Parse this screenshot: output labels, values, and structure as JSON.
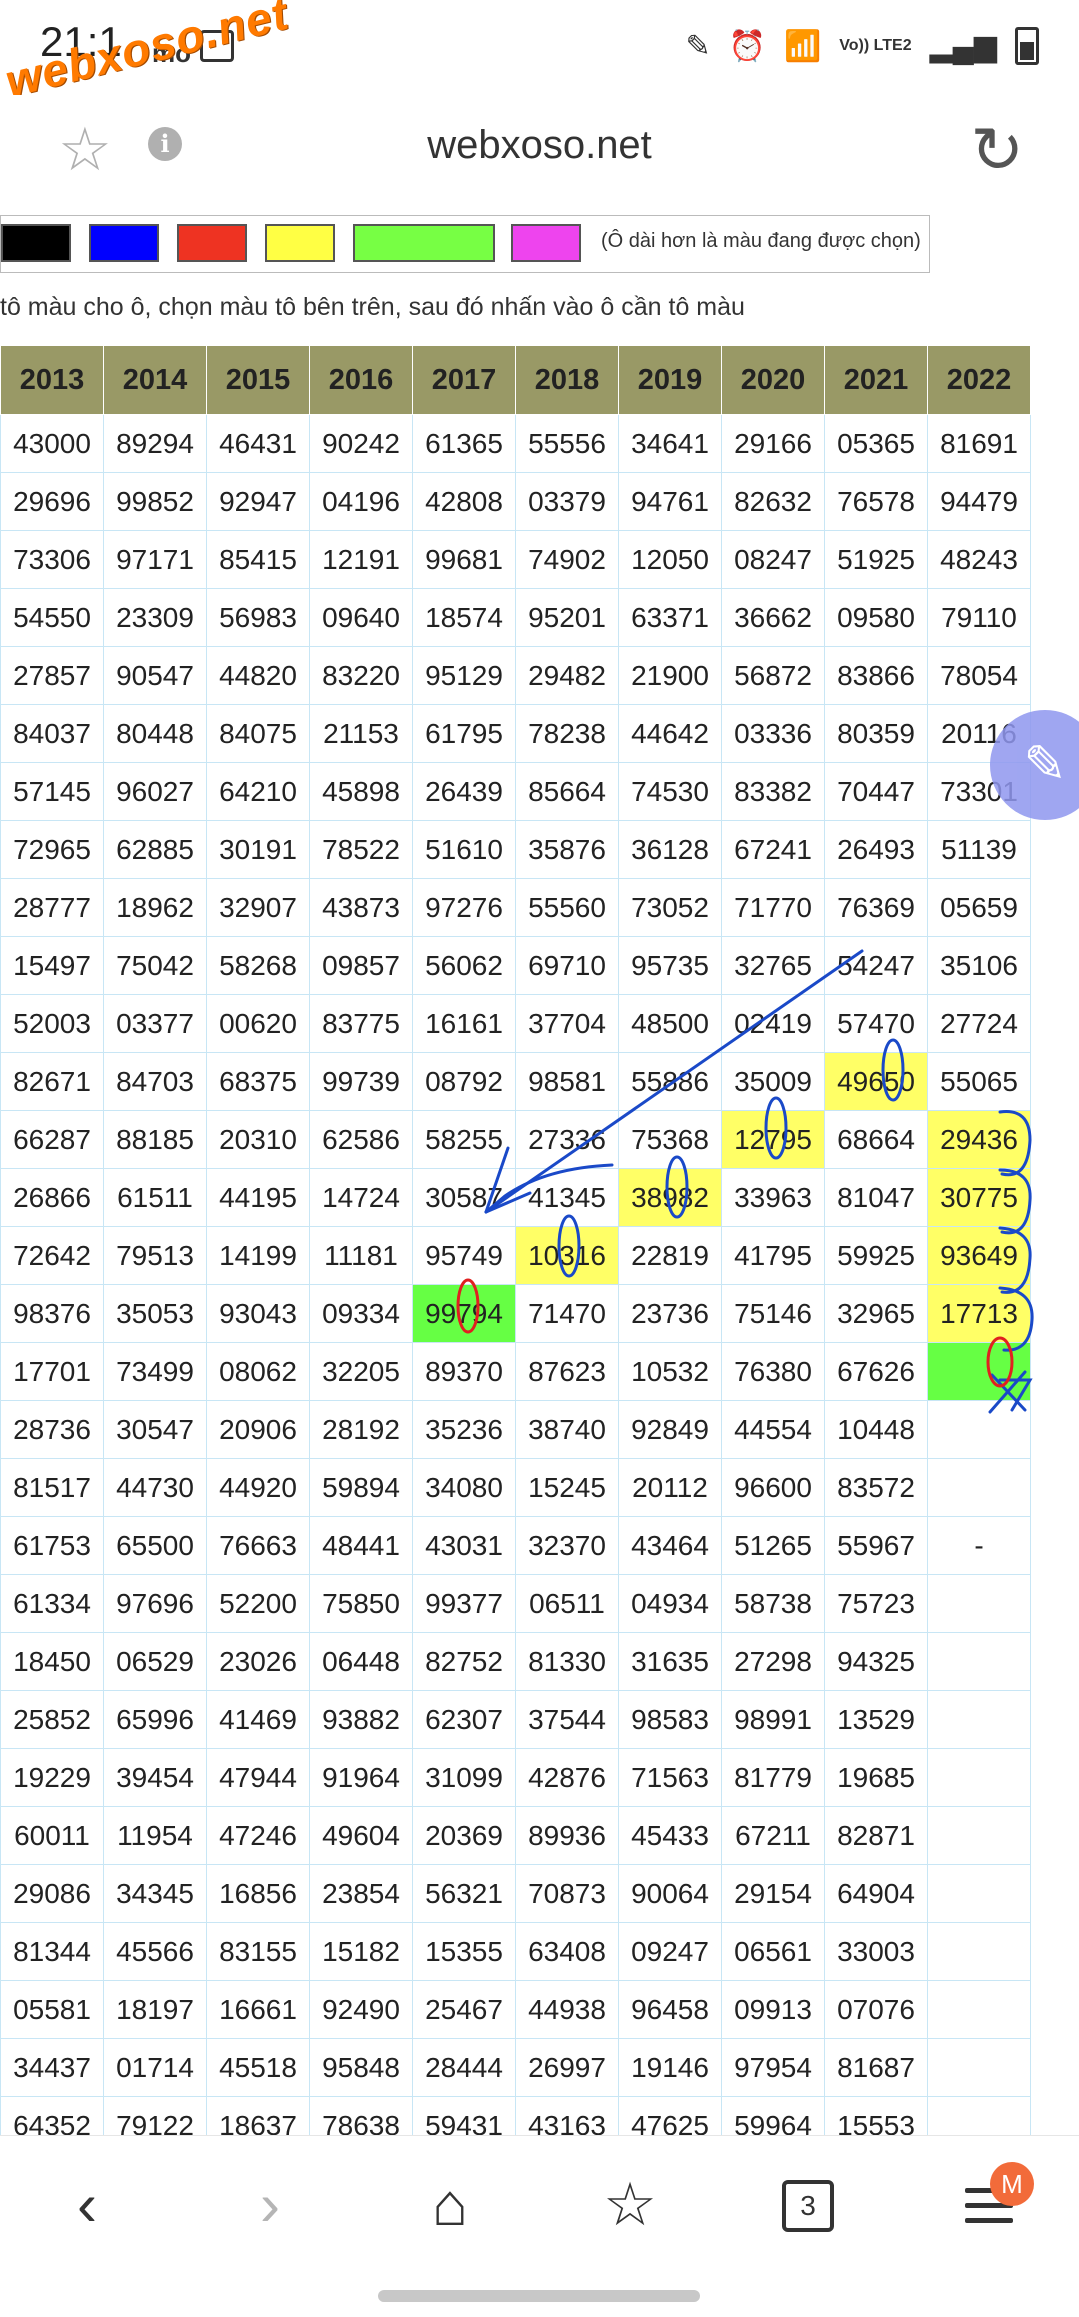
{
  "status": {
    "time": "21:1",
    "indicator": "mo",
    "watermark": "webxoso.net",
    "lte": "Vo)) LTE2",
    "icons": [
      "pencil-icon",
      "alarm-icon",
      "wifi-icon",
      "signal-icon",
      "battery-icon"
    ]
  },
  "browser": {
    "url": "webxoso.net",
    "info": "i"
  },
  "palette": {
    "colors": [
      "#000000",
      "#0000ff",
      "#ee3322",
      "#ffff44",
      "#77ff44",
      "#ee44ee"
    ],
    "note": "(Ô dài hơn là màu đang được chọn)"
  },
  "instruction": "tô màu cho ô, chọn màu tô bên trên, sau đó nhấn vào ô cần tô màu",
  "table": {
    "headers": [
      "2013",
      "2014",
      "2015",
      "2016",
      "2017",
      "2018",
      "2019",
      "2020",
      "2021",
      "2022"
    ],
    "rows": [
      [
        "43000",
        "89294",
        "46431",
        "90242",
        "61365",
        "55556",
        "34641",
        "29166",
        "05365",
        "81691"
      ],
      [
        "29696",
        "99852",
        "92947",
        "04196",
        "42808",
        "03379",
        "94761",
        "82632",
        "76578",
        "94479"
      ],
      [
        "73306",
        "97171",
        "85415",
        "12191",
        "99681",
        "74902",
        "12050",
        "08247",
        "51925",
        "48243"
      ],
      [
        "54550",
        "23309",
        "56983",
        "09640",
        "18574",
        "95201",
        "63371",
        "36662",
        "09580",
        "79110"
      ],
      [
        "27857",
        "90547",
        "44820",
        "83220",
        "95129",
        "29482",
        "21900",
        "56872",
        "83866",
        "78054"
      ],
      [
        "84037",
        "80448",
        "84075",
        "21153",
        "61795",
        "78238",
        "44642",
        "03336",
        "80359",
        "20116"
      ],
      [
        "57145",
        "96027",
        "64210",
        "45898",
        "26439",
        "85664",
        "74530",
        "83382",
        "70447",
        "73301"
      ],
      [
        "72965",
        "62885",
        "30191",
        "78522",
        "51610",
        "35876",
        "36128",
        "67241",
        "26493",
        "51139"
      ],
      [
        "28777",
        "18962",
        "32907",
        "43873",
        "97276",
        "55560",
        "73052",
        "71770",
        "76369",
        "05659"
      ],
      [
        "15497",
        "75042",
        "58268",
        "09857",
        "56062",
        "69710",
        "95735",
        "32765",
        "54247",
        "35106"
      ],
      [
        "52003",
        "03377",
        "00620",
        "83775",
        "16161",
        "37704",
        "48500",
        "02419",
        "57470",
        "27724"
      ],
      [
        "82671",
        "84703",
        "68375",
        "99739",
        "08792",
        "98581",
        "55886",
        "35009",
        "49650",
        "55065"
      ],
      [
        "66287",
        "88185",
        "20310",
        "62586",
        "58255",
        "27336",
        "75368",
        "12795",
        "68664",
        "29436"
      ],
      [
        "26866",
        "61511",
        "44195",
        "14724",
        "30587",
        "41345",
        "38982",
        "33963",
        "81047",
        "30775"
      ],
      [
        "72642",
        "79513",
        "14199",
        "11181",
        "95749",
        "10316",
        "22819",
        "41795",
        "59925",
        "93649"
      ],
      [
        "98376",
        "35053",
        "93043",
        "09334",
        "99794",
        "71470",
        "23736",
        "75146",
        "32965",
        "17713"
      ],
      [
        "17701",
        "73499",
        "08062",
        "32205",
        "89370",
        "87623",
        "10532",
        "76380",
        "67626",
        ""
      ],
      [
        "28736",
        "30547",
        "20906",
        "28192",
        "35236",
        "38740",
        "92849",
        "44554",
        "10448",
        ""
      ],
      [
        "81517",
        "44730",
        "44920",
        "59894",
        "34080",
        "15245",
        "20112",
        "96600",
        "83572",
        ""
      ],
      [
        "61753",
        "65500",
        "76663",
        "48441",
        "43031",
        "32370",
        "43464",
        "51265",
        "55967",
        "-"
      ],
      [
        "61334",
        "97696",
        "52200",
        "75850",
        "99377",
        "06511",
        "04934",
        "58738",
        "75723",
        ""
      ],
      [
        "18450",
        "06529",
        "23026",
        "06448",
        "82752",
        "81330",
        "31635",
        "27298",
        "94325",
        ""
      ],
      [
        "25852",
        "65996",
        "41469",
        "93882",
        "62307",
        "37544",
        "98583",
        "98991",
        "13529",
        ""
      ],
      [
        "19229",
        "39454",
        "47944",
        "91964",
        "31099",
        "42876",
        "71563",
        "81779",
        "19685",
        ""
      ],
      [
        "60011",
        "11954",
        "47246",
        "49604",
        "20369",
        "89936",
        "45433",
        "67211",
        "82871",
        ""
      ],
      [
        "29086",
        "34345",
        "16856",
        "23854",
        "56321",
        "70873",
        "90064",
        "29154",
        "64904",
        ""
      ],
      [
        "81344",
        "45566",
        "83155",
        "15182",
        "15355",
        "63408",
        "09247",
        "06561",
        "33003",
        ""
      ],
      [
        "05581",
        "18197",
        "16661",
        "92490",
        "25467",
        "44938",
        "96458",
        "09913",
        "07076",
        ""
      ],
      [
        "34437",
        "01714",
        "45518",
        "95848",
        "28444",
        "26997",
        "19146",
        "97954",
        "81687",
        ""
      ],
      [
        "64352",
        "79122",
        "18637",
        "78638",
        "59431",
        "43163",
        "47625",
        "59964",
        "15553",
        ""
      ]
    ],
    "highlights": {
      "yellow": [
        [
          11,
          8
        ],
        [
          12,
          7
        ],
        [
          12,
          9
        ],
        [
          13,
          6
        ],
        [
          13,
          9
        ],
        [
          14,
          5
        ],
        [
          14,
          9
        ],
        [
          15,
          9
        ]
      ],
      "green": [
        [
          15,
          4
        ],
        [
          16,
          9
        ]
      ]
    }
  },
  "nav": {
    "tab_count": "3",
    "avatar": "M"
  }
}
